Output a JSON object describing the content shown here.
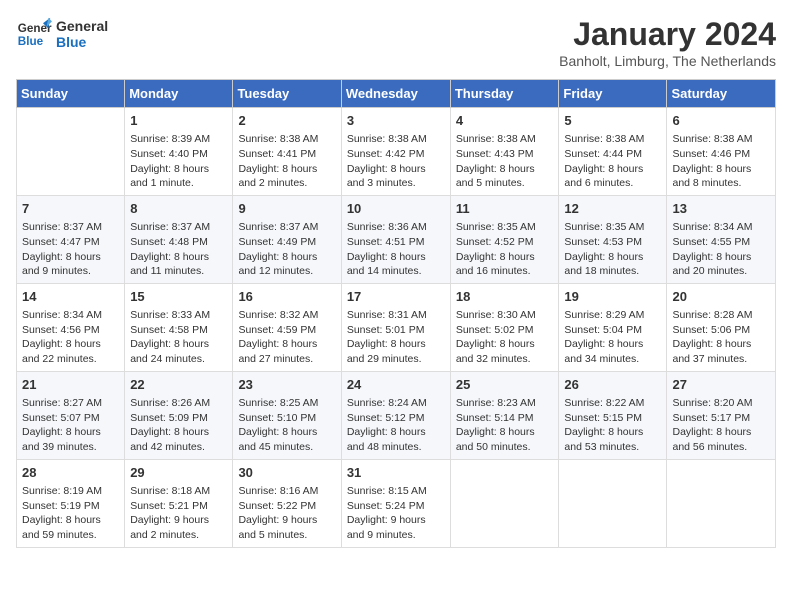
{
  "logo": {
    "line1": "General",
    "line2": "Blue"
  },
  "title": "January 2024",
  "subtitle": "Banholt, Limburg, The Netherlands",
  "days_of_week": [
    "Sunday",
    "Monday",
    "Tuesday",
    "Wednesday",
    "Thursday",
    "Friday",
    "Saturday"
  ],
  "weeks": [
    [
      {
        "day": "",
        "sunrise": "",
        "sunset": "",
        "daylight": ""
      },
      {
        "day": "1",
        "sunrise": "Sunrise: 8:39 AM",
        "sunset": "Sunset: 4:40 PM",
        "daylight": "Daylight: 8 hours and 1 minute."
      },
      {
        "day": "2",
        "sunrise": "Sunrise: 8:38 AM",
        "sunset": "Sunset: 4:41 PM",
        "daylight": "Daylight: 8 hours and 2 minutes."
      },
      {
        "day": "3",
        "sunrise": "Sunrise: 8:38 AM",
        "sunset": "Sunset: 4:42 PM",
        "daylight": "Daylight: 8 hours and 3 minutes."
      },
      {
        "day": "4",
        "sunrise": "Sunrise: 8:38 AM",
        "sunset": "Sunset: 4:43 PM",
        "daylight": "Daylight: 8 hours and 5 minutes."
      },
      {
        "day": "5",
        "sunrise": "Sunrise: 8:38 AM",
        "sunset": "Sunset: 4:44 PM",
        "daylight": "Daylight: 8 hours and 6 minutes."
      },
      {
        "day": "6",
        "sunrise": "Sunrise: 8:38 AM",
        "sunset": "Sunset: 4:46 PM",
        "daylight": "Daylight: 8 hours and 8 minutes."
      }
    ],
    [
      {
        "day": "7",
        "sunrise": "Sunrise: 8:37 AM",
        "sunset": "Sunset: 4:47 PM",
        "daylight": "Daylight: 8 hours and 9 minutes."
      },
      {
        "day": "8",
        "sunrise": "Sunrise: 8:37 AM",
        "sunset": "Sunset: 4:48 PM",
        "daylight": "Daylight: 8 hours and 11 minutes."
      },
      {
        "day": "9",
        "sunrise": "Sunrise: 8:37 AM",
        "sunset": "Sunset: 4:49 PM",
        "daylight": "Daylight: 8 hours and 12 minutes."
      },
      {
        "day": "10",
        "sunrise": "Sunrise: 8:36 AM",
        "sunset": "Sunset: 4:51 PM",
        "daylight": "Daylight: 8 hours and 14 minutes."
      },
      {
        "day": "11",
        "sunrise": "Sunrise: 8:35 AM",
        "sunset": "Sunset: 4:52 PM",
        "daylight": "Daylight: 8 hours and 16 minutes."
      },
      {
        "day": "12",
        "sunrise": "Sunrise: 8:35 AM",
        "sunset": "Sunset: 4:53 PM",
        "daylight": "Daylight: 8 hours and 18 minutes."
      },
      {
        "day": "13",
        "sunrise": "Sunrise: 8:34 AM",
        "sunset": "Sunset: 4:55 PM",
        "daylight": "Daylight: 8 hours and 20 minutes."
      }
    ],
    [
      {
        "day": "14",
        "sunrise": "Sunrise: 8:34 AM",
        "sunset": "Sunset: 4:56 PM",
        "daylight": "Daylight: 8 hours and 22 minutes."
      },
      {
        "day": "15",
        "sunrise": "Sunrise: 8:33 AM",
        "sunset": "Sunset: 4:58 PM",
        "daylight": "Daylight: 8 hours and 24 minutes."
      },
      {
        "day": "16",
        "sunrise": "Sunrise: 8:32 AM",
        "sunset": "Sunset: 4:59 PM",
        "daylight": "Daylight: 8 hours and 27 minutes."
      },
      {
        "day": "17",
        "sunrise": "Sunrise: 8:31 AM",
        "sunset": "Sunset: 5:01 PM",
        "daylight": "Daylight: 8 hours and 29 minutes."
      },
      {
        "day": "18",
        "sunrise": "Sunrise: 8:30 AM",
        "sunset": "Sunset: 5:02 PM",
        "daylight": "Daylight: 8 hours and 32 minutes."
      },
      {
        "day": "19",
        "sunrise": "Sunrise: 8:29 AM",
        "sunset": "Sunset: 5:04 PM",
        "daylight": "Daylight: 8 hours and 34 minutes."
      },
      {
        "day": "20",
        "sunrise": "Sunrise: 8:28 AM",
        "sunset": "Sunset: 5:06 PM",
        "daylight": "Daylight: 8 hours and 37 minutes."
      }
    ],
    [
      {
        "day": "21",
        "sunrise": "Sunrise: 8:27 AM",
        "sunset": "Sunset: 5:07 PM",
        "daylight": "Daylight: 8 hours and 39 minutes."
      },
      {
        "day": "22",
        "sunrise": "Sunrise: 8:26 AM",
        "sunset": "Sunset: 5:09 PM",
        "daylight": "Daylight: 8 hours and 42 minutes."
      },
      {
        "day": "23",
        "sunrise": "Sunrise: 8:25 AM",
        "sunset": "Sunset: 5:10 PM",
        "daylight": "Daylight: 8 hours and 45 minutes."
      },
      {
        "day": "24",
        "sunrise": "Sunrise: 8:24 AM",
        "sunset": "Sunset: 5:12 PM",
        "daylight": "Daylight: 8 hours and 48 minutes."
      },
      {
        "day": "25",
        "sunrise": "Sunrise: 8:23 AM",
        "sunset": "Sunset: 5:14 PM",
        "daylight": "Daylight: 8 hours and 50 minutes."
      },
      {
        "day": "26",
        "sunrise": "Sunrise: 8:22 AM",
        "sunset": "Sunset: 5:15 PM",
        "daylight": "Daylight: 8 hours and 53 minutes."
      },
      {
        "day": "27",
        "sunrise": "Sunrise: 8:20 AM",
        "sunset": "Sunset: 5:17 PM",
        "daylight": "Daylight: 8 hours and 56 minutes."
      }
    ],
    [
      {
        "day": "28",
        "sunrise": "Sunrise: 8:19 AM",
        "sunset": "Sunset: 5:19 PM",
        "daylight": "Daylight: 8 hours and 59 minutes."
      },
      {
        "day": "29",
        "sunrise": "Sunrise: 8:18 AM",
        "sunset": "Sunset: 5:21 PM",
        "daylight": "Daylight: 9 hours and 2 minutes."
      },
      {
        "day": "30",
        "sunrise": "Sunrise: 8:16 AM",
        "sunset": "Sunset: 5:22 PM",
        "daylight": "Daylight: 9 hours and 5 minutes."
      },
      {
        "day": "31",
        "sunrise": "Sunrise: 8:15 AM",
        "sunset": "Sunset: 5:24 PM",
        "daylight": "Daylight: 9 hours and 9 minutes."
      },
      {
        "day": "",
        "sunrise": "",
        "sunset": "",
        "daylight": ""
      },
      {
        "day": "",
        "sunrise": "",
        "sunset": "",
        "daylight": ""
      },
      {
        "day": "",
        "sunrise": "",
        "sunset": "",
        "daylight": ""
      }
    ]
  ]
}
